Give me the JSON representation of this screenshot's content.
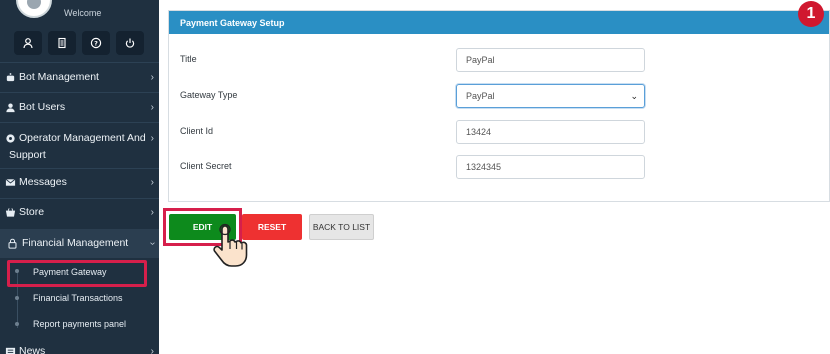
{
  "sidebar": {
    "welcome": "Welcome",
    "quick_icons": [
      "user-icon",
      "document-icon",
      "help-icon",
      "power-icon"
    ],
    "items": [
      {
        "label": "Bot Management",
        "icon": "bot-icon"
      },
      {
        "label": "Bot Users",
        "icon": "users-icon"
      },
      {
        "label": "Operator Management And",
        "label2": "Support",
        "icon": "operator-icon"
      },
      {
        "label": "Messages",
        "icon": "mail-icon"
      },
      {
        "label": "Store",
        "icon": "store-icon"
      },
      {
        "label": "Financial Management",
        "icon": "lock-icon"
      },
      {
        "label": "News",
        "icon": "news-icon"
      }
    ],
    "sub_items": [
      "Payment Gateway",
      "Financial Transactions",
      "Report payments panel"
    ]
  },
  "card": {
    "title": "Payment Gateway Setup",
    "fields": [
      {
        "label": "Title",
        "value": "PayPal"
      },
      {
        "label": "Gateway Type",
        "value": "PayPal"
      },
      {
        "label": "Client Id",
        "value": "13424"
      },
      {
        "label": "Client Secret",
        "value": "1324345"
      }
    ]
  },
  "buttons": {
    "edit": "EDIT",
    "reset": "RESET",
    "back": "BACK TO LIST"
  },
  "step_badge": "1",
  "colors": {
    "sidebar": "#1f3040",
    "header": "#2a8fc4",
    "edit": "#0d8a1c",
    "reset": "#ee3131",
    "highlight": "#d61f4b"
  }
}
